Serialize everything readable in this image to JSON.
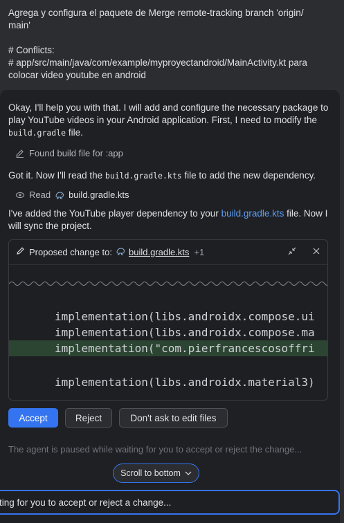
{
  "user_message": {
    "lines": [
      "Agrega y configura el paquete de Merge remote-tracking branch 'origin/",
      "main'",
      "",
      "# Conflicts:",
      "# app/src/main/java/com/example/myproyectandroid/MainActivity.kt para",
      "colocar video youtube en android"
    ]
  },
  "agent": {
    "intro_part1": "Okay, I'll help you with that. I will add and configure the necessary package to play YouTube videos in your Android application. First, I need to modify the ",
    "intro_code": "build.gradle",
    "intro_part2": " file.",
    "step_found": "Found build file for :app",
    "read_part1": "Got it. Now I'll read the ",
    "read_code": "build.gradle.kts",
    "read_part2": " file to add the new dependency.",
    "step_read_label": "Read",
    "step_read_file": "build.gradle.kts",
    "added_part1": "I've added the YouTube player dependency to your ",
    "added_link": "build.gradle.kts",
    "added_part2": " file. Now I will sync the project."
  },
  "diff": {
    "header_label": "Proposed change to:",
    "file": "build.gradle.kts",
    "extra_count": "+1",
    "lines": [
      "implementation(libs.androidx.compose.ui",
      "implementation(libs.androidx.compose.ma",
      "implementation(\"com.pierfrancescosoffri",
      "",
      "implementation(libs.androidx.material3)"
    ]
  },
  "actions": {
    "accept": "Accept",
    "reject": "Reject",
    "dont_ask": "Don't ask to edit files"
  },
  "paused_text": "The agent is paused while waiting for you to accept or reject the change...",
  "scroll_to_bottom": "Scroll to bottom",
  "input_placeholder": "iting for you to accept or reject a change...",
  "colors": {
    "accent": "#3574f0",
    "link": "#5e9ef5",
    "added_line_bg": "#2c4532",
    "panel_bg": "#1f2023",
    "window_bg": "#2b2d30"
  }
}
